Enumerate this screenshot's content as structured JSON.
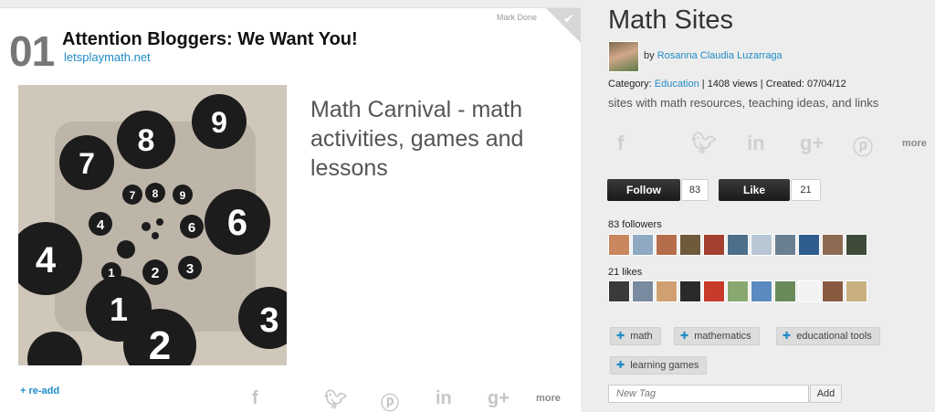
{
  "card": {
    "rank": "01",
    "title": "Attention Bloggers: We Want You!",
    "site": "letsplaymath.net",
    "mark_done": "Mark Done",
    "description": "Math Carnival - math activities, games and lessons",
    "readd": "+ re-add",
    "share_icons": [
      "facebook-icon",
      "twitter-icon",
      "pinterest-icon",
      "linkedin-icon",
      "googleplus-icon"
    ],
    "more": "more"
  },
  "panel": {
    "title": "Math Sites",
    "by": "by",
    "author": "Rosanna Claudia Luzarraga",
    "category_label": "Category:",
    "category": "Education",
    "views": "1408 views",
    "created": "Created: 07/04/12",
    "description": "sites with math resources, teaching ideas, and links",
    "more": "more",
    "follow_label": "Follow",
    "follow_count": "83",
    "like_label": "Like",
    "like_count": "21",
    "followers_label": "83 followers",
    "likes_label": "21 likes",
    "tags": [
      "math",
      "mathematics",
      "educational tools",
      "learning games"
    ],
    "new_tag_placeholder": "New Tag",
    "add_label": "Add"
  },
  "colors": {
    "link": "#1f8bc6",
    "button": "#222222"
  }
}
